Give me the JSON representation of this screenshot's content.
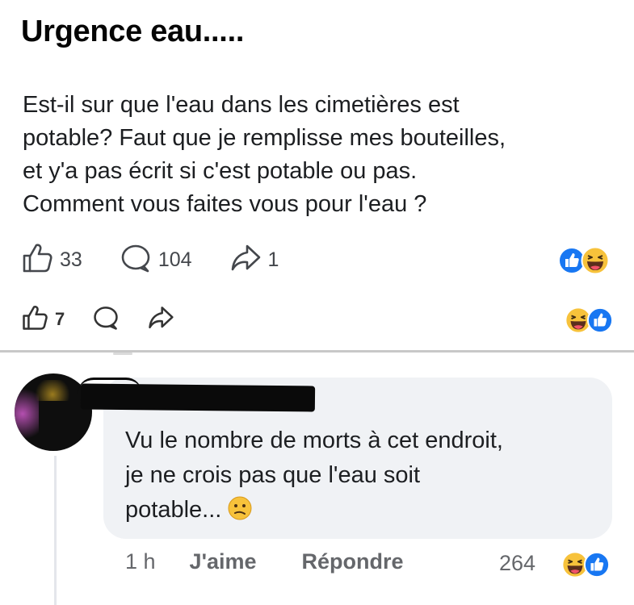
{
  "post": {
    "title": "Urgence eau.....",
    "body_lines": [
      "Est-il sur que l'eau dans les cimetières est",
      "potable? Faut que je remplisse mes bouteilles,",
      "et y'a pas écrit si c'est potable ou pas.",
      "Comment vous faites vous pour l'eau ?"
    ],
    "likes": "33",
    "comments": "104",
    "shares": "1",
    "reactions": [
      "like-icon",
      "laugh-icon"
    ]
  },
  "sub_actions": {
    "likes": "7",
    "reactions": [
      "laugh-icon",
      "like-icon"
    ]
  },
  "comment": {
    "author_name": "",
    "lines": [
      "Vu le nombre de morts à cet endroit,",
      "je ne crois pas que l'eau soit",
      "potable..."
    ],
    "emoji": "confused-face-icon",
    "time": "1 h",
    "like_label": "J'aime",
    "reply_label": "Répondre",
    "reaction_count": "264",
    "reactions": [
      "laugh-icon",
      "like-icon"
    ]
  },
  "colors": {
    "like_blue": "#1877f2",
    "emoji_yellow": "#f7c23b",
    "bubble_bg": "#f0f2f5",
    "muted_text": "#65676b"
  }
}
